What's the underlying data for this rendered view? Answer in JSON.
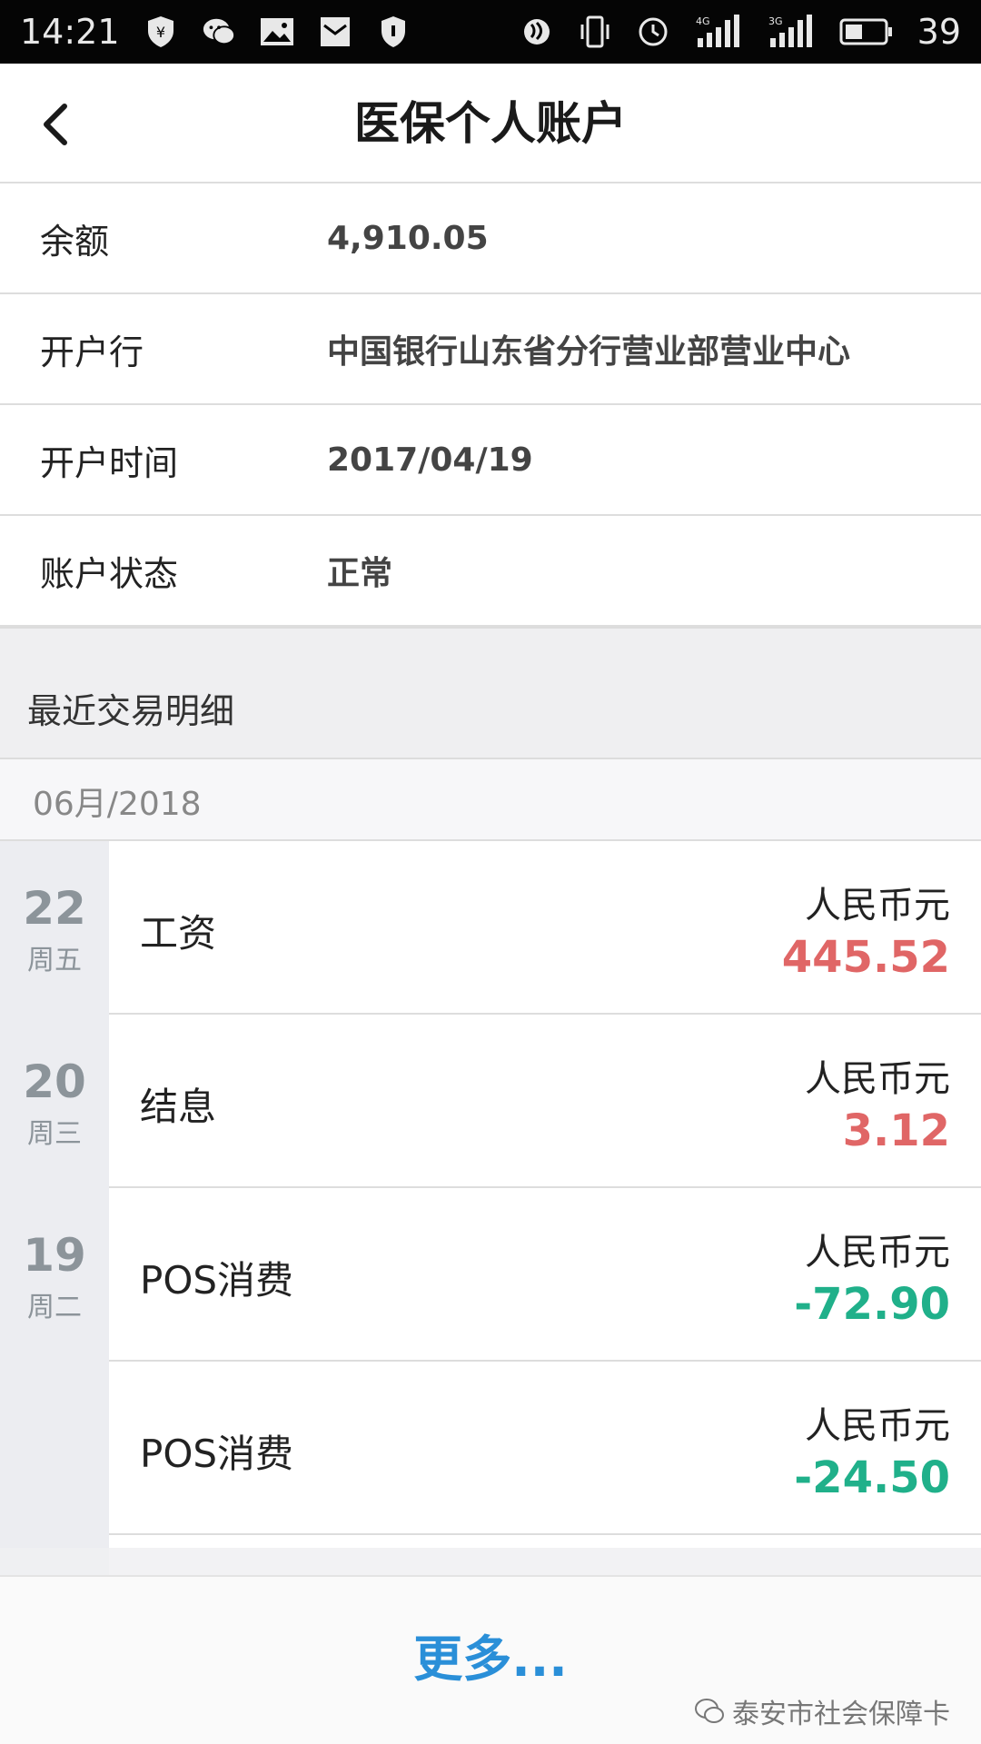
{
  "status_bar": {
    "time": "14:21",
    "battery": "39",
    "icons": [
      "shield-yen-icon",
      "wechat-icon",
      "image-icon",
      "mail-icon",
      "shield-icon",
      "nfc-icon",
      "vibrate-icon",
      "alarm-icon",
      "signal-4g-icon",
      "signal-3g-icon",
      "battery-icon"
    ],
    "net_4g": "4G",
    "net_3g": "3G"
  },
  "header": {
    "title": "医保个人账户"
  },
  "account": {
    "rows": [
      {
        "label": "余额",
        "value": "4,910.05"
      },
      {
        "label": "开户行",
        "value": "中国银行山东省分行营业部营业中心"
      },
      {
        "label": "开户时间",
        "value": "2017/04/19"
      },
      {
        "label": "账户状态",
        "value": "正常"
      }
    ]
  },
  "transactions": {
    "section_title": "最近交易明细",
    "month": "06月/2018",
    "items": [
      {
        "day": "22",
        "weekday": "周五",
        "name": "工资",
        "currency": "人民币元",
        "amount": "445.52",
        "sign": "positive"
      },
      {
        "day": "20",
        "weekday": "周三",
        "name": "结息",
        "currency": "人民币元",
        "amount": "3.12",
        "sign": "positive"
      },
      {
        "day": "19",
        "weekday": "周二",
        "name": "POS消费",
        "currency": "人民币元",
        "amount": "-72.90",
        "sign": "negative"
      },
      {
        "day": "",
        "weekday": "",
        "name": "POS消费",
        "currency": "人民币元",
        "amount": "-24.50",
        "sign": "negative"
      }
    ]
  },
  "footer": {
    "more_label": "更多...",
    "watermark": "泰安市社会保障卡"
  },
  "colors": {
    "positive": "#e06666",
    "negative": "#20b08a",
    "link": "#2a8fd8"
  }
}
